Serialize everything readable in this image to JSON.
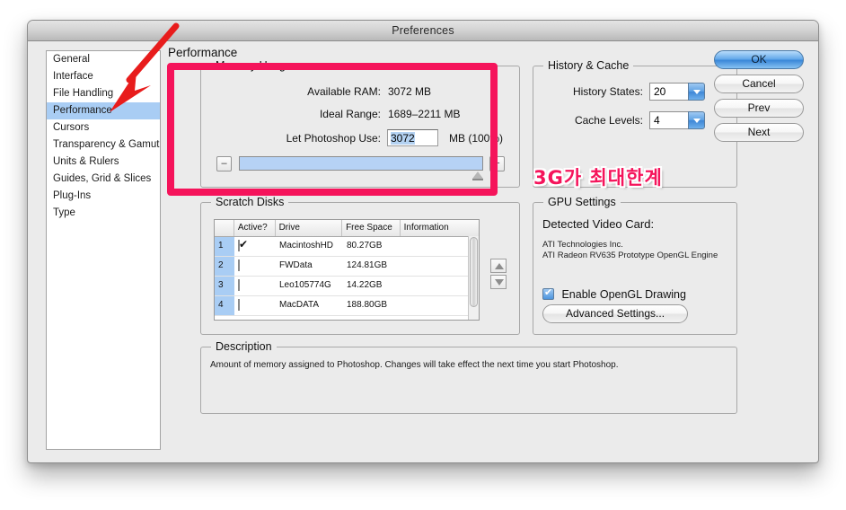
{
  "window": {
    "title": "Preferences"
  },
  "sidebar": {
    "items": [
      {
        "label": "General",
        "selected": false
      },
      {
        "label": "Interface",
        "selected": false
      },
      {
        "label": "File Handling",
        "selected": false
      },
      {
        "label": "Performance",
        "selected": true
      },
      {
        "label": "Cursors",
        "selected": false
      },
      {
        "label": "Transparency & Gamut",
        "selected": false
      },
      {
        "label": "Units & Rulers",
        "selected": false
      },
      {
        "label": "Guides, Grid & Slices",
        "selected": false
      },
      {
        "label": "Plug-Ins",
        "selected": false
      },
      {
        "label": "Type",
        "selected": false
      }
    ]
  },
  "pane": {
    "title": "Performance"
  },
  "memory_usage": {
    "legend": "Memory Usage",
    "available_ram_label": "Available RAM:",
    "available_ram_value": "3072 MB",
    "ideal_range_label": "Ideal Range:",
    "ideal_range_value": "1689–2211 MB",
    "let_photoshop_use_label": "Let Photoshop Use:",
    "let_photoshop_use_value": "3072",
    "unit_suffix": "MB (100%)",
    "minus_label": "–",
    "plus_label": "+",
    "slider_percent": 100
  },
  "history_cache": {
    "legend": "History & Cache",
    "history_states_label": "History States:",
    "history_states_value": "20",
    "cache_levels_label": "Cache Levels:",
    "cache_levels_value": "4"
  },
  "scratch_disks": {
    "legend": "Scratch Disks",
    "columns": [
      "",
      "Active?",
      "Drive",
      "Free Space",
      "Information"
    ],
    "rows": [
      {
        "index": "1",
        "active": true,
        "drive": "MacintoshHD",
        "free_space": "80.27GB",
        "information": ""
      },
      {
        "index": "2",
        "active": false,
        "drive": "FWData",
        "free_space": "124.81GB",
        "information": ""
      },
      {
        "index": "3",
        "active": false,
        "drive": "Leo105774G",
        "free_space": "14.22GB",
        "information": ""
      },
      {
        "index": "4",
        "active": false,
        "drive": "MacDATA",
        "free_space": "188.80GB",
        "information": ""
      }
    ]
  },
  "gpu_settings": {
    "legend": "GPU Settings",
    "detected_label": "Detected Video Card:",
    "vendor": "ATI Technologies Inc.",
    "renderer": "ATI Radeon RV635 Prototype OpenGL Engine",
    "enable_opengl_label": "Enable OpenGL Drawing",
    "enable_opengl_checked": true,
    "advanced_settings_label": "Advanced Settings..."
  },
  "description": {
    "legend": "Description",
    "text": "Amount of memory assigned to Photoshop. Changes will take effect the next time you start Photoshop."
  },
  "buttons": {
    "ok": "OK",
    "cancel": "Cancel",
    "prev": "Prev",
    "next": "Next"
  },
  "annotations": {
    "korean_note": "3G가 최대한계",
    "highlight_color": "#f5145b",
    "arrow_color": "#e81c1c"
  }
}
